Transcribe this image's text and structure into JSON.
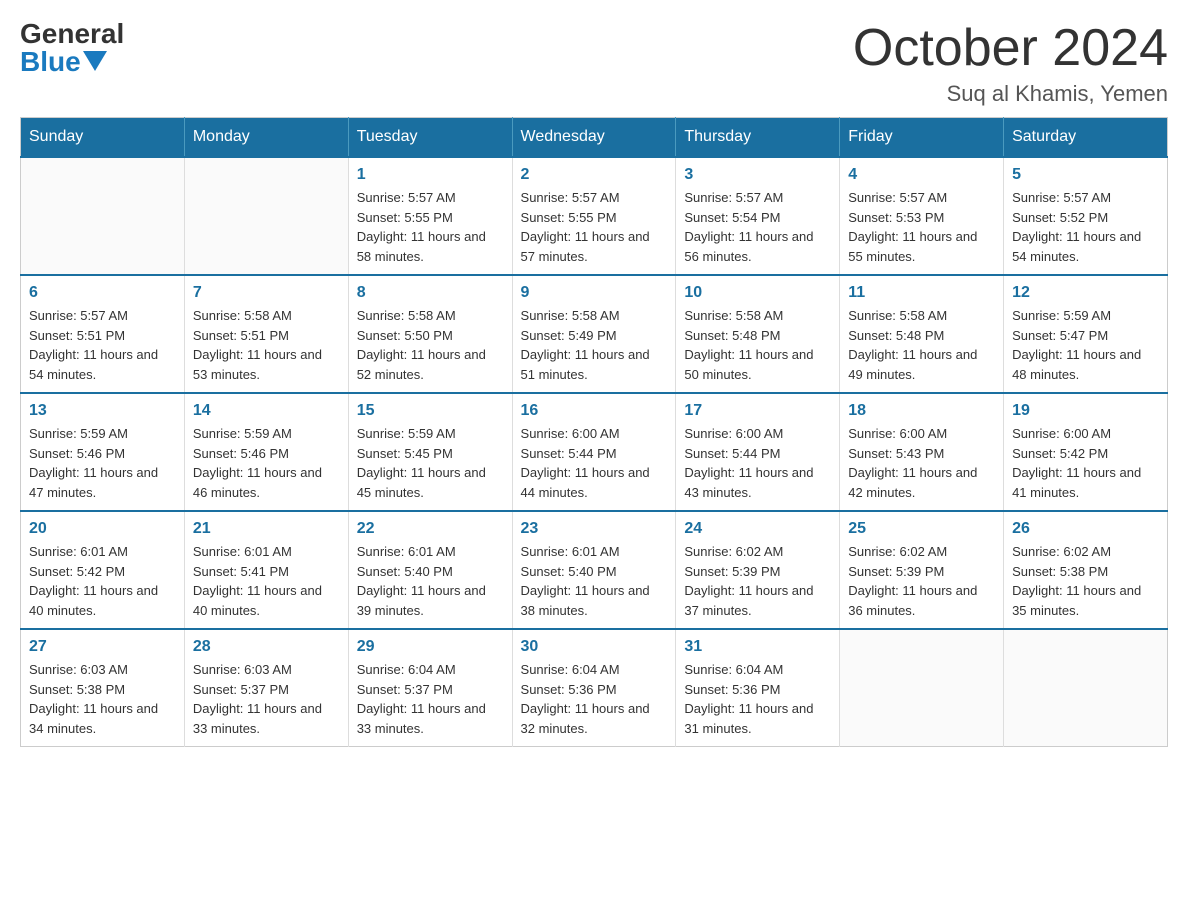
{
  "logo": {
    "general": "General",
    "blue": "Blue"
  },
  "header": {
    "title": "October 2024",
    "location": "Suq al Khamis, Yemen"
  },
  "weekdays": [
    "Sunday",
    "Monday",
    "Tuesday",
    "Wednesday",
    "Thursday",
    "Friday",
    "Saturday"
  ],
  "weeks": [
    [
      {
        "day": "",
        "sunrise": "",
        "sunset": "",
        "daylight": ""
      },
      {
        "day": "",
        "sunrise": "",
        "sunset": "",
        "daylight": ""
      },
      {
        "day": "1",
        "sunrise": "Sunrise: 5:57 AM",
        "sunset": "Sunset: 5:55 PM",
        "daylight": "Daylight: 11 hours and 58 minutes."
      },
      {
        "day": "2",
        "sunrise": "Sunrise: 5:57 AM",
        "sunset": "Sunset: 5:55 PM",
        "daylight": "Daylight: 11 hours and 57 minutes."
      },
      {
        "day": "3",
        "sunrise": "Sunrise: 5:57 AM",
        "sunset": "Sunset: 5:54 PM",
        "daylight": "Daylight: 11 hours and 56 minutes."
      },
      {
        "day": "4",
        "sunrise": "Sunrise: 5:57 AM",
        "sunset": "Sunset: 5:53 PM",
        "daylight": "Daylight: 11 hours and 55 minutes."
      },
      {
        "day": "5",
        "sunrise": "Sunrise: 5:57 AM",
        "sunset": "Sunset: 5:52 PM",
        "daylight": "Daylight: 11 hours and 54 minutes."
      }
    ],
    [
      {
        "day": "6",
        "sunrise": "Sunrise: 5:57 AM",
        "sunset": "Sunset: 5:51 PM",
        "daylight": "Daylight: 11 hours and 54 minutes."
      },
      {
        "day": "7",
        "sunrise": "Sunrise: 5:58 AM",
        "sunset": "Sunset: 5:51 PM",
        "daylight": "Daylight: 11 hours and 53 minutes."
      },
      {
        "day": "8",
        "sunrise": "Sunrise: 5:58 AM",
        "sunset": "Sunset: 5:50 PM",
        "daylight": "Daylight: 11 hours and 52 minutes."
      },
      {
        "day": "9",
        "sunrise": "Sunrise: 5:58 AM",
        "sunset": "Sunset: 5:49 PM",
        "daylight": "Daylight: 11 hours and 51 minutes."
      },
      {
        "day": "10",
        "sunrise": "Sunrise: 5:58 AM",
        "sunset": "Sunset: 5:48 PM",
        "daylight": "Daylight: 11 hours and 50 minutes."
      },
      {
        "day": "11",
        "sunrise": "Sunrise: 5:58 AM",
        "sunset": "Sunset: 5:48 PM",
        "daylight": "Daylight: 11 hours and 49 minutes."
      },
      {
        "day": "12",
        "sunrise": "Sunrise: 5:59 AM",
        "sunset": "Sunset: 5:47 PM",
        "daylight": "Daylight: 11 hours and 48 minutes."
      }
    ],
    [
      {
        "day": "13",
        "sunrise": "Sunrise: 5:59 AM",
        "sunset": "Sunset: 5:46 PM",
        "daylight": "Daylight: 11 hours and 47 minutes."
      },
      {
        "day": "14",
        "sunrise": "Sunrise: 5:59 AM",
        "sunset": "Sunset: 5:46 PM",
        "daylight": "Daylight: 11 hours and 46 minutes."
      },
      {
        "day": "15",
        "sunrise": "Sunrise: 5:59 AM",
        "sunset": "Sunset: 5:45 PM",
        "daylight": "Daylight: 11 hours and 45 minutes."
      },
      {
        "day": "16",
        "sunrise": "Sunrise: 6:00 AM",
        "sunset": "Sunset: 5:44 PM",
        "daylight": "Daylight: 11 hours and 44 minutes."
      },
      {
        "day": "17",
        "sunrise": "Sunrise: 6:00 AM",
        "sunset": "Sunset: 5:44 PM",
        "daylight": "Daylight: 11 hours and 43 minutes."
      },
      {
        "day": "18",
        "sunrise": "Sunrise: 6:00 AM",
        "sunset": "Sunset: 5:43 PM",
        "daylight": "Daylight: 11 hours and 42 minutes."
      },
      {
        "day": "19",
        "sunrise": "Sunrise: 6:00 AM",
        "sunset": "Sunset: 5:42 PM",
        "daylight": "Daylight: 11 hours and 41 minutes."
      }
    ],
    [
      {
        "day": "20",
        "sunrise": "Sunrise: 6:01 AM",
        "sunset": "Sunset: 5:42 PM",
        "daylight": "Daylight: 11 hours and 40 minutes."
      },
      {
        "day": "21",
        "sunrise": "Sunrise: 6:01 AM",
        "sunset": "Sunset: 5:41 PM",
        "daylight": "Daylight: 11 hours and 40 minutes."
      },
      {
        "day": "22",
        "sunrise": "Sunrise: 6:01 AM",
        "sunset": "Sunset: 5:40 PM",
        "daylight": "Daylight: 11 hours and 39 minutes."
      },
      {
        "day": "23",
        "sunrise": "Sunrise: 6:01 AM",
        "sunset": "Sunset: 5:40 PM",
        "daylight": "Daylight: 11 hours and 38 minutes."
      },
      {
        "day": "24",
        "sunrise": "Sunrise: 6:02 AM",
        "sunset": "Sunset: 5:39 PM",
        "daylight": "Daylight: 11 hours and 37 minutes."
      },
      {
        "day": "25",
        "sunrise": "Sunrise: 6:02 AM",
        "sunset": "Sunset: 5:39 PM",
        "daylight": "Daylight: 11 hours and 36 minutes."
      },
      {
        "day": "26",
        "sunrise": "Sunrise: 6:02 AM",
        "sunset": "Sunset: 5:38 PM",
        "daylight": "Daylight: 11 hours and 35 minutes."
      }
    ],
    [
      {
        "day": "27",
        "sunrise": "Sunrise: 6:03 AM",
        "sunset": "Sunset: 5:38 PM",
        "daylight": "Daylight: 11 hours and 34 minutes."
      },
      {
        "day": "28",
        "sunrise": "Sunrise: 6:03 AM",
        "sunset": "Sunset: 5:37 PM",
        "daylight": "Daylight: 11 hours and 33 minutes."
      },
      {
        "day": "29",
        "sunrise": "Sunrise: 6:04 AM",
        "sunset": "Sunset: 5:37 PM",
        "daylight": "Daylight: 11 hours and 33 minutes."
      },
      {
        "day": "30",
        "sunrise": "Sunrise: 6:04 AM",
        "sunset": "Sunset: 5:36 PM",
        "daylight": "Daylight: 11 hours and 32 minutes."
      },
      {
        "day": "31",
        "sunrise": "Sunrise: 6:04 AM",
        "sunset": "Sunset: 5:36 PM",
        "daylight": "Daylight: 11 hours and 31 minutes."
      },
      {
        "day": "",
        "sunrise": "",
        "sunset": "",
        "daylight": ""
      },
      {
        "day": "",
        "sunrise": "",
        "sunset": "",
        "daylight": ""
      }
    ]
  ]
}
